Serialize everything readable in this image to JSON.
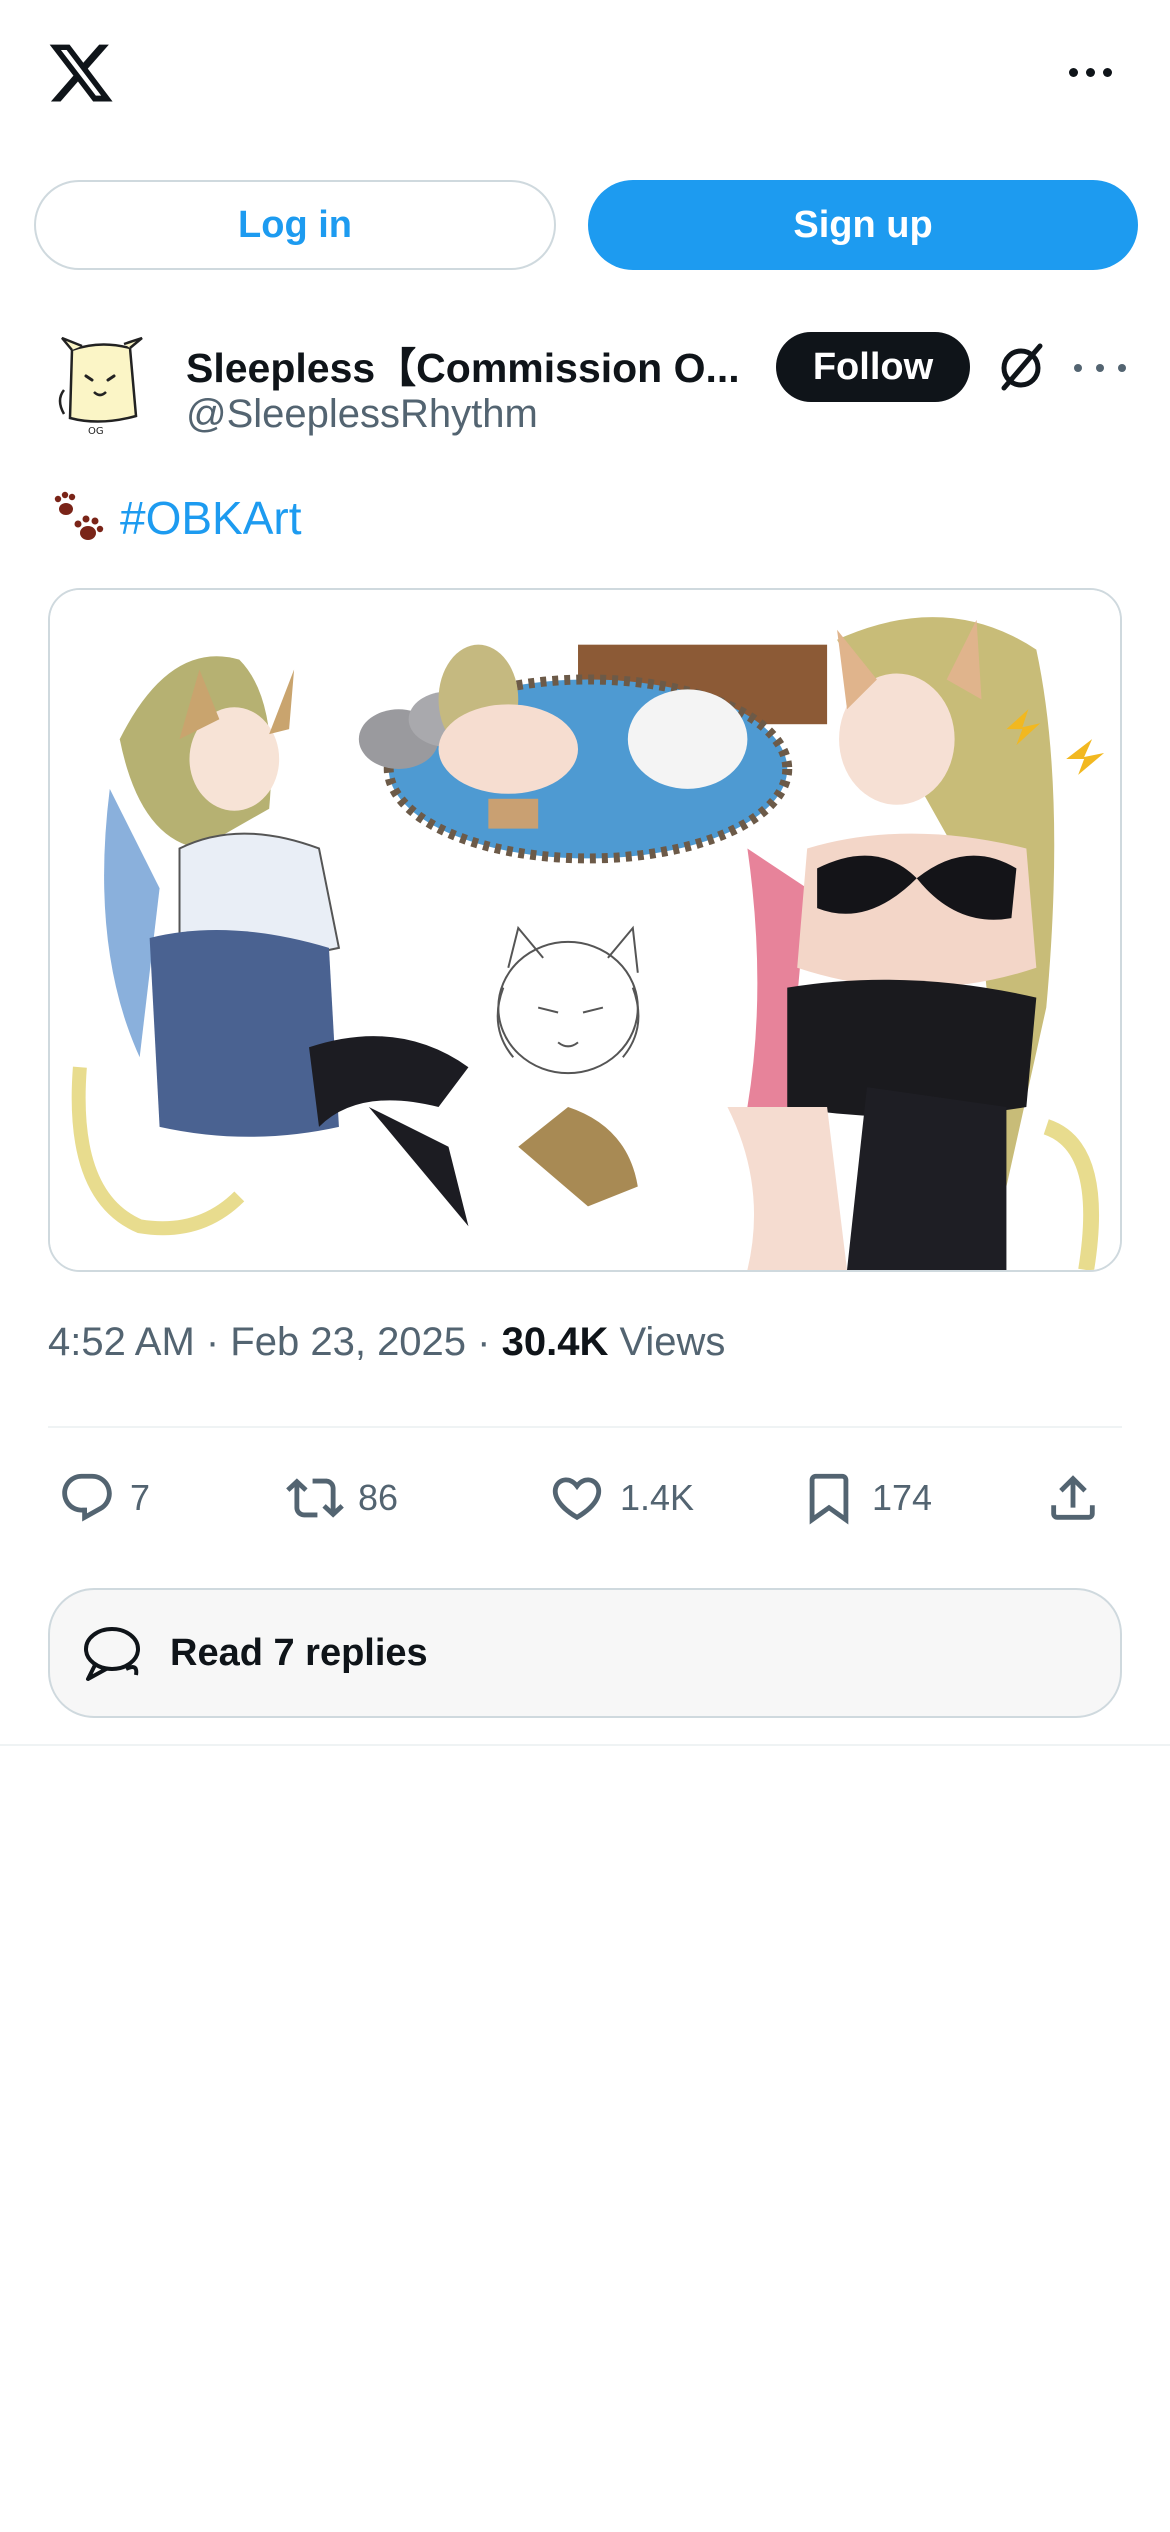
{
  "header": {
    "logo_icon": "x-logo-icon",
    "more_icon": "more-horizontal-icon"
  },
  "auth": {
    "login_label": "Log in",
    "signup_label": "Sign up"
  },
  "post": {
    "author_name": "Sleepless【Commission O...",
    "author_handle": "@SleeplessRhythm",
    "follow_label": "Follow",
    "text": {
      "emoji_icon": "paw-prints-icon",
      "hashtag": "#OBKArt"
    },
    "media_alt_icon": "artwork-image",
    "timestamp": "4:52 AM · Feb 23, 2025 · ",
    "views_count": "30.4K",
    "views_label": " Views",
    "actions": {
      "replies": "7",
      "reposts": "86",
      "likes": "1.4K",
      "bookmarks": "174"
    },
    "read_replies_label": "Read 7 replies"
  },
  "colors": {
    "accent": "#1d9bf0",
    "text_primary": "#0f1419",
    "text_secondary": "#536471",
    "border": "#cfd9de"
  }
}
